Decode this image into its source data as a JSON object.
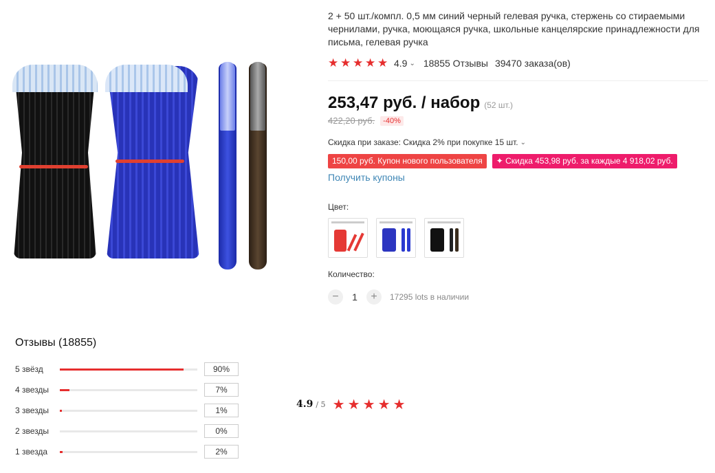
{
  "product": {
    "title": "2 + 50 шт./компл. 0,5 мм синий черный гелевая ручка, стержень со стираемыми чернилами, ручка, моющаяся ручка, школьные канцелярские принадлежности для письма, гелевая ручка",
    "rating": "4.9",
    "reviews": "18855 Отзывы",
    "orders": "39470 заказа(ов)",
    "price": "253,47 руб. / набор",
    "pcs": "(52 шт.)",
    "old_price": "422,20 руб.",
    "discount": "-40%",
    "bulk_discount": "Скидка при заказе: Скидка 2% при покупке 15 шт.",
    "coupon_new_user": "150,00 руб. Купон нового пользователя",
    "coupon_every": "✦ Скидка 453,98 руб. за каждые 4 918,02 руб.",
    "get_coupons": "Получить купоны",
    "color_label": "Цвет:",
    "quantity_label": "Количество:",
    "quantity": "1",
    "stock": "17295 lots в наличии",
    "colors": [
      "red",
      "blue",
      "black"
    ],
    "accent": "#e62e2e"
  },
  "reviews": {
    "title": "Отзывы (18855)",
    "rows": [
      {
        "label": "5 звёзд",
        "pct": "90%",
        "share": 0.9
      },
      {
        "label": "4 звезды",
        "pct": "7%",
        "share": 0.07
      },
      {
        "label": "3 звезды",
        "pct": "1%",
        "share": 0.01
      },
      {
        "label": "2 звезды",
        "pct": "0%",
        "share": 0.0
      },
      {
        "label": "1 звезда",
        "pct": "2%",
        "share": 0.02
      }
    ],
    "avg": "4.9",
    "avg_of": "/ 5"
  }
}
